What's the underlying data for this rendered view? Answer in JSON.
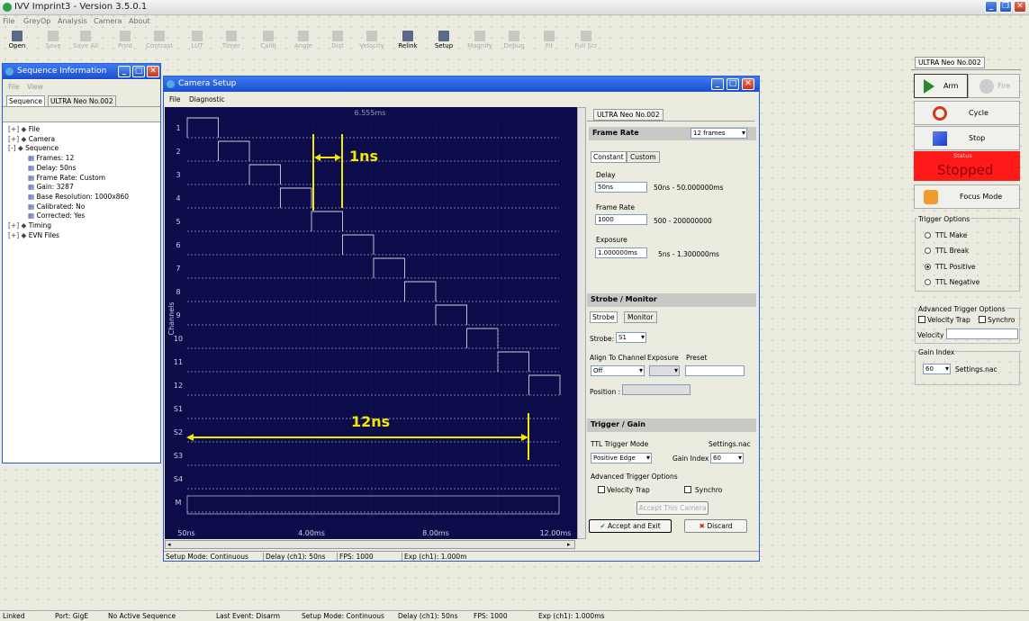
{
  "app": {
    "title": "IVV Imprint3 - Version 3.5.0.1"
  },
  "menu": [
    "File",
    "GreyOp",
    "Analysis",
    "Camera",
    "About"
  ],
  "toolbar": [
    {
      "label": "Open",
      "on": true
    },
    {
      "label": "Save",
      "on": false
    },
    {
      "label": "Save All",
      "on": false
    },
    {
      "label": "Print",
      "on": false
    },
    {
      "label": "Contrast",
      "on": false
    },
    {
      "label": "LUT",
      "on": false
    },
    {
      "label": "Timer",
      "on": false
    },
    {
      "label": "Calib",
      "on": false
    },
    {
      "label": "Angle",
      "on": false
    },
    {
      "label": "Dist",
      "on": false
    },
    {
      "label": "Velocity",
      "on": false
    },
    {
      "label": "Relink",
      "on": true
    },
    {
      "label": "Setup",
      "on": true
    },
    {
      "label": "Magnify",
      "on": false
    },
    {
      "label": "Debug",
      "on": false
    },
    {
      "label": "Fit",
      "on": false
    },
    {
      "label": "Full Scr",
      "on": false
    }
  ],
  "seq": {
    "title": "Sequence Information",
    "menu": [
      "File",
      "View"
    ],
    "tabs": [
      "Sequence",
      "ULTRA Neo No.002"
    ],
    "tree": [
      {
        "d": 0,
        "t": "File",
        "s": "+"
      },
      {
        "d": 0,
        "t": "Camera",
        "s": "+"
      },
      {
        "d": 0,
        "t": "Sequence",
        "s": "-"
      },
      {
        "d": 1,
        "t": "Frames: 12"
      },
      {
        "d": 1,
        "t": "Delay: 50ns"
      },
      {
        "d": 1,
        "t": "Frame Rate: Custom"
      },
      {
        "d": 1,
        "t": "Gain: 3287"
      },
      {
        "d": 1,
        "t": "Base Resolution: 1000x860"
      },
      {
        "d": 1,
        "t": "Calibrated: No"
      },
      {
        "d": 1,
        "t": "Corrected: Yes"
      },
      {
        "d": 0,
        "t": "Timing",
        "s": "+"
      },
      {
        "d": 0,
        "t": "EVN Files",
        "s": "+"
      }
    ]
  },
  "cam": {
    "title": "Camera Setup",
    "menu": [
      "File",
      "Diagnostic"
    ],
    "plot": {
      "top_label": "6.555ms",
      "y_axis": "Channels",
      "channels": [
        "1",
        "2",
        "3",
        "4",
        "5",
        "6",
        "7",
        "8",
        "9",
        "10",
        "11",
        "12",
        "S1",
        "S2",
        "S3",
        "S4",
        "M"
      ],
      "x_ticks": [
        "50ns",
        "4.00ms",
        "8.00ms",
        "12.00ms"
      ],
      "annot_1": "1ns",
      "annot_2": "12ns"
    },
    "tab": "ULTRA Neo No.002",
    "frame_rate": {
      "header": "Frame Rate",
      "frames": "12 frames",
      "tabs": [
        "Constant",
        "Custom"
      ],
      "delay_label": "Delay",
      "delay": "50ns",
      "delay_range": "50ns - 50.000000ms",
      "fr_label": "Frame Rate",
      "fr": "1000",
      "fr_range": "500 - 200000000",
      "exp_label": "Exposure",
      "exp": "1.000000ms",
      "exp_range": "5ns - 1.300000ms"
    },
    "strobe": {
      "header": "Strobe / Monitor",
      "tabs": [
        "Strobe",
        "Monitor"
      ],
      "strobe_label": "Strobe:",
      "strobe": "S1",
      "align_label": "Align To Channel",
      "exp_label": "Exposure",
      "preset_label": "Preset",
      "align": "Off",
      "pos_label": "Position :"
    },
    "trigger": {
      "header": "Trigger / Gain",
      "mode_label": "TTL Trigger Mode",
      "settings": "Settings.nac",
      "mode": "Positive Edge",
      "gain_label": "Gain Index",
      "gain": "60",
      "adv": "Advanced Trigger Options",
      "vt": "Velocity Trap",
      "sync": "Synchro",
      "accept_cam": "Accept This Camera",
      "accept_exit": "Accept and Exit",
      "discard": "Discard"
    },
    "status": [
      "Setup Mode: Continuous",
      "Delay (ch1): 50ns",
      "FPS: 1000",
      "Exp (ch1): 1.000m"
    ]
  },
  "right": {
    "tab": "ULTRA Neo No.002",
    "arm": "Arm",
    "fire": "Fire",
    "cycle": "Cycle",
    "stop": "Stop",
    "status_label": "Status",
    "status": "Stopped",
    "focus": "Focus Mode",
    "trig_title": "Trigger Options",
    "trig": [
      "TTL Make",
      "TTL Break",
      "TTL Positive",
      "TTL Negative"
    ],
    "adv_title": "Advanced Trigger Options",
    "vt": "Velocity Trap",
    "sync": "Synchro",
    "velocity": "Velocity",
    "gain_title": "Gain Index",
    "gain": "60",
    "settings": "Settings.nac"
  },
  "statusbar": [
    "Linked",
    "Port: GigE",
    "No Active Sequence",
    "Last Event: Disarm",
    "Setup Mode: Continuous",
    "Delay (ch1): 50ns",
    "FPS: 1000",
    "Exp (ch1): 1.000ms"
  ]
}
